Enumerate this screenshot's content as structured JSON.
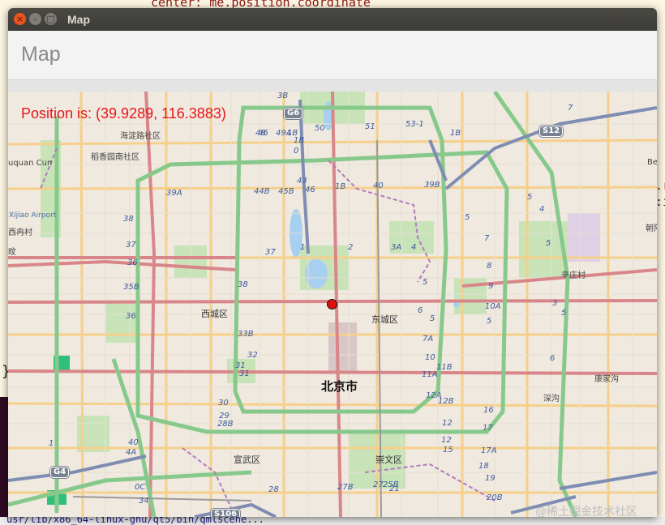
{
  "background": {
    "code_top": "center: me.position.coordinate",
    "code_brace": "}",
    "code_right1": ".r",
    "code_right2": ":i",
    "terminal_path": "usr/lib/x86_64-linux-gnu/qt5/bin/qmlscene..."
  },
  "window": {
    "title": "Map",
    "buttons": {
      "close": "×",
      "minimize": "–",
      "maximize": "□"
    }
  },
  "header": {
    "title": "Map"
  },
  "map": {
    "position_text": "Position is: (39.9289, 116.3883)",
    "district_labels": [
      {
        "id": "haidian",
        "text": "海淀路社区"
      },
      {
        "id": "daoxiang",
        "text": "稻香园南社区"
      },
      {
        "id": "yuquan",
        "text": "uquan Cun"
      },
      {
        "id": "airport",
        "text": "Xijiao Airport"
      },
      {
        "id": "ximencun",
        "text": "西冉村"
      },
      {
        "id": "village2",
        "text": "旼"
      },
      {
        "id": "xicheng",
        "text": "西城区"
      },
      {
        "id": "dongcheng",
        "text": "东城区"
      },
      {
        "id": "beijing",
        "text": "北京市"
      },
      {
        "id": "xuanwu",
        "text": "宣武区"
      },
      {
        "id": "chongwen",
        "text": "崇文区"
      },
      {
        "id": "xinzhuang",
        "text": "辛庄村"
      },
      {
        "id": "kangjiagou",
        "text": "康家沟"
      },
      {
        "id": "shengou",
        "text": "深沟"
      },
      {
        "id": "chaoyang",
        "text": "朝阳"
      },
      {
        "id": "be",
        "text": "Be"
      },
      {
        "id": "watermark",
        "text": "@稀土掘金技术社区"
      }
    ],
    "route_labels": [
      "3B",
      "46",
      "1B",
      "49A",
      "48",
      "50",
      "51",
      "53-1",
      "1B",
      "1B",
      "0",
      "43",
      "44B",
      "45B",
      "46",
      "1B",
      "40",
      "39B",
      "39A",
      "38",
      "37",
      "36",
      "35B",
      "36",
      "37",
      "1",
      "2",
      "3A",
      "4",
      "5",
      "5",
      "6",
      "7",
      "8",
      "9",
      "10A",
      "3",
      "5",
      "6",
      "7",
      "5",
      "4",
      "5",
      "5",
      "5",
      "7A",
      "10",
      "11A",
      "11B",
      "12A",
      "12B",
      "12",
      "12",
      "15",
      "16",
      "17",
      "17A",
      "18",
      "19",
      "20B",
      "21",
      "25B",
      "27",
      "27B",
      "28",
      "28B",
      "29",
      "30",
      "31",
      "31",
      "32",
      "33B",
      "0C",
      "34",
      "38",
      "40",
      "4A",
      "1"
    ],
    "shields": [
      "G6",
      "S12",
      "G4",
      "S106"
    ]
  }
}
